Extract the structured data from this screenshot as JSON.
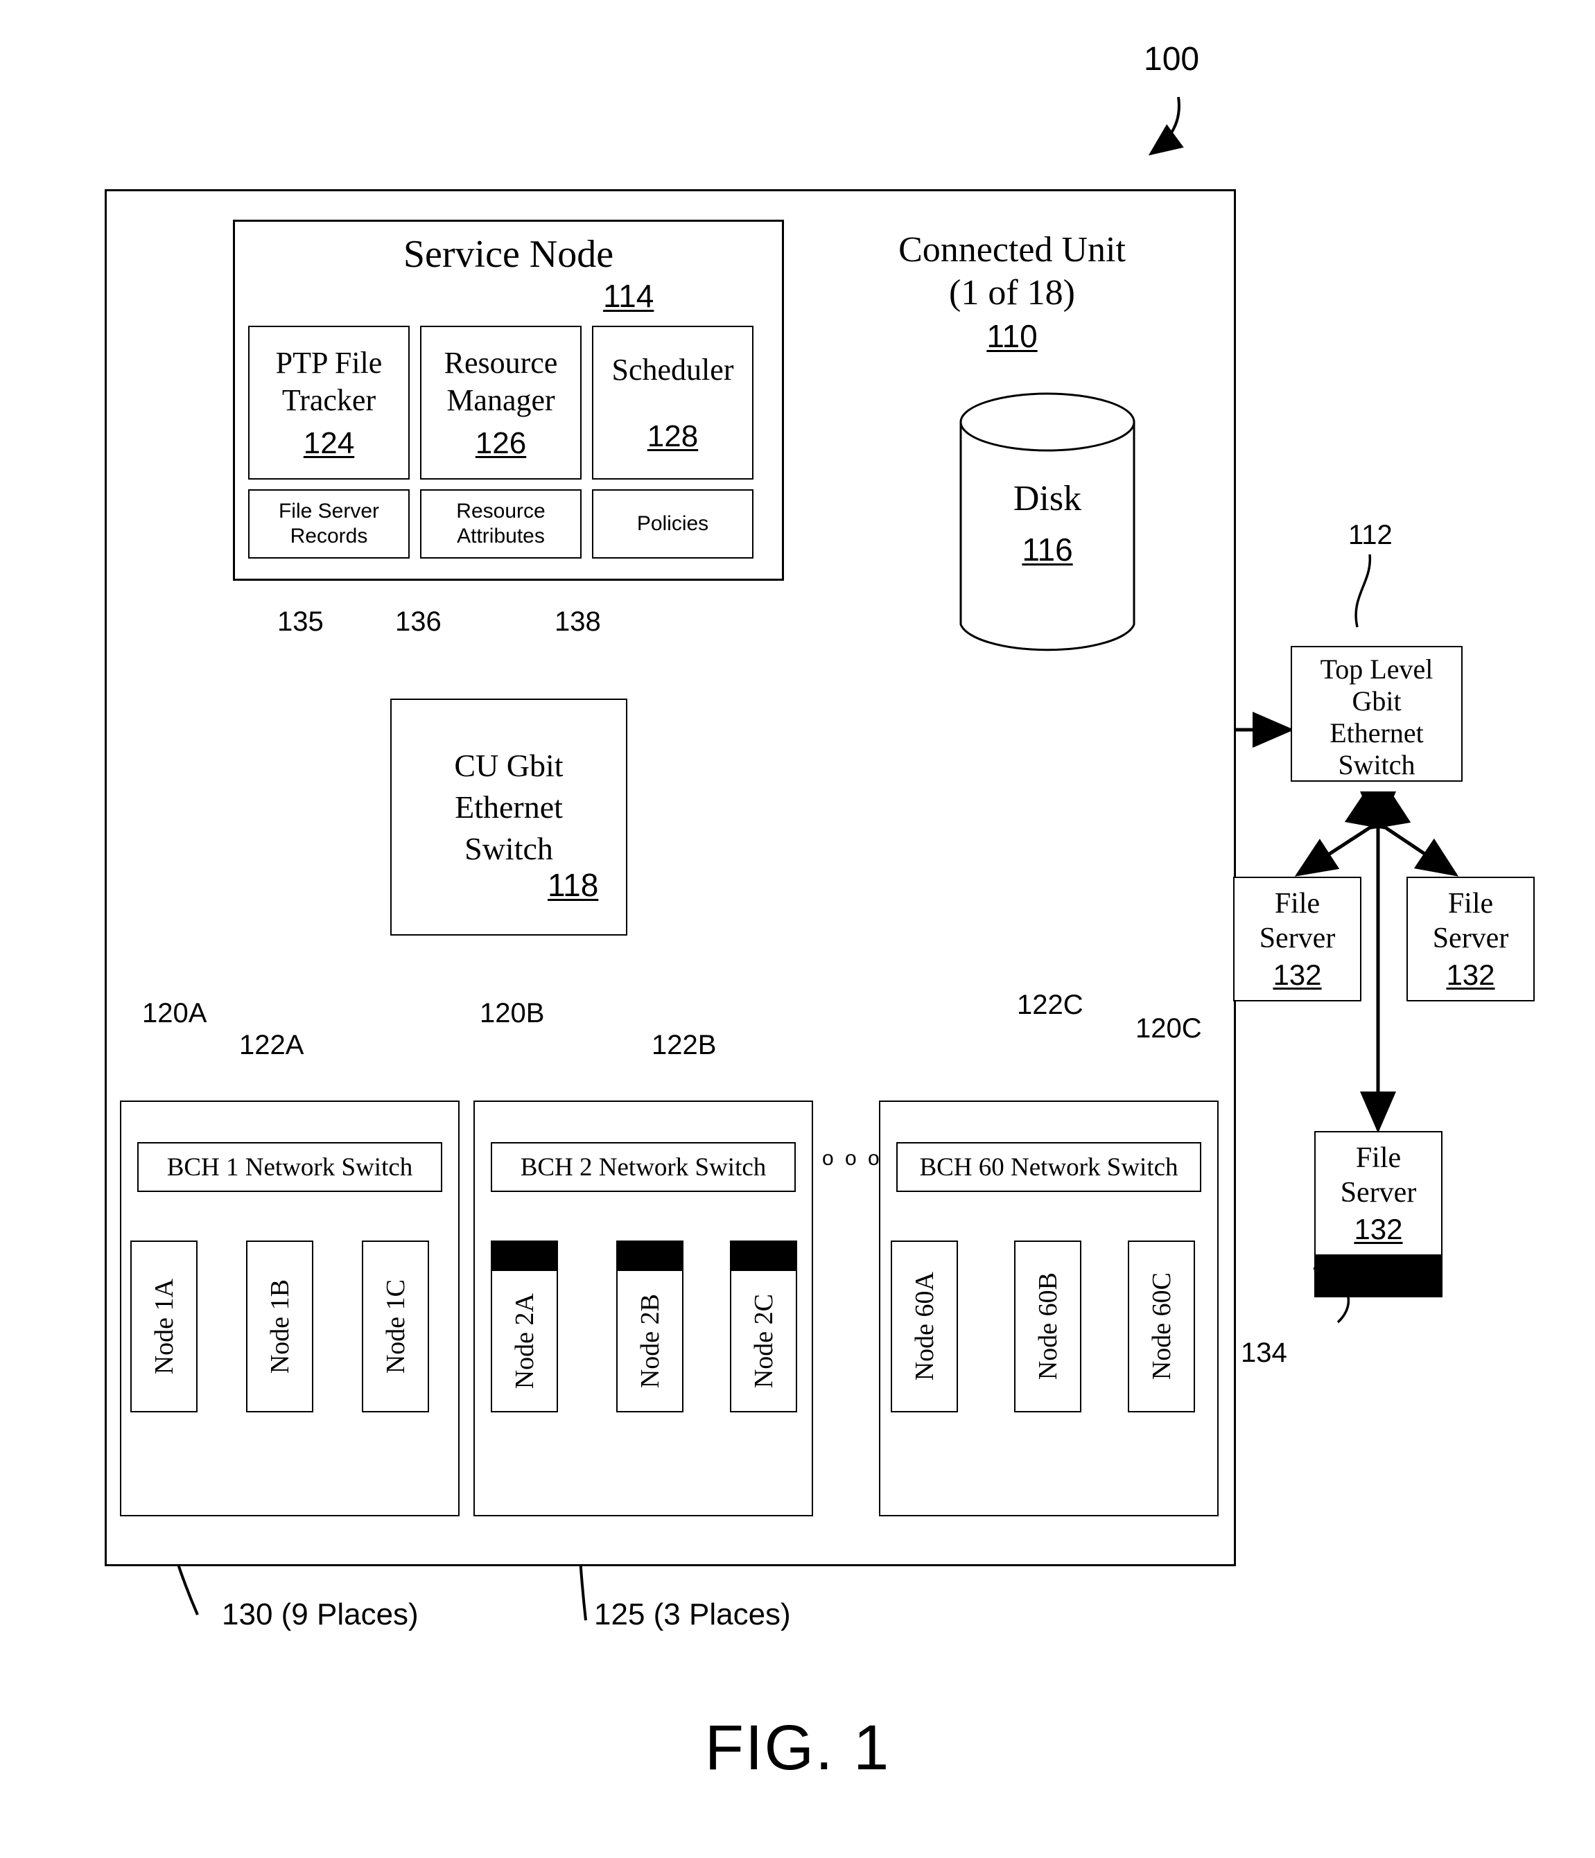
{
  "figure": {
    "caption": "FIG. 1",
    "system_ref": "100"
  },
  "connected_unit": {
    "title_line1": "Connected Unit",
    "title_line2": "(1 of 18)",
    "ref": "110"
  },
  "service_node": {
    "title": "Service Node",
    "ref": "114",
    "modules": [
      {
        "name_line1": "PTP File",
        "name_line2": "Tracker",
        "ref": "124"
      },
      {
        "name_line1": "Resource",
        "name_line2": "Manager",
        "ref": "126"
      },
      {
        "name_line1": "Scheduler",
        "name_line2": "",
        "ref": "128"
      }
    ],
    "stores": [
      {
        "line1": "File Server",
        "line2": "Records",
        "ref": "135"
      },
      {
        "line1": "Resource",
        "line2": "Attributes",
        "ref": "136"
      },
      {
        "line1": "Policies",
        "line2": "",
        "ref": "138"
      }
    ]
  },
  "disk": {
    "label": "Disk",
    "ref": "116"
  },
  "cu_switch": {
    "line1": "CU Gbit",
    "line2": "Ethernet",
    "line3": "Switch",
    "ref": "118"
  },
  "top_switch": {
    "line1": "Top Level",
    "line2": "Gbit",
    "line3": "Ethernet",
    "line4": "Switch",
    "ref": "112"
  },
  "file_servers": [
    {
      "line1": "File",
      "line2": "Server",
      "ref": "132",
      "has_black_bar": false
    },
    {
      "line1": "File",
      "line2": "Server",
      "ref": "132",
      "has_black_bar": false
    },
    {
      "line1": "File",
      "line2": "Server",
      "ref": "132",
      "has_black_bar": true
    }
  ],
  "file_server_bar_ref": "134",
  "racks": [
    {
      "rack_ref": "120A",
      "switch_ref": "122A",
      "switch_label": "BCH 1 Network Switch",
      "nodes": [
        {
          "label": "Node 1A",
          "has_black_bar": false
        },
        {
          "label": "Node 1B",
          "has_black_bar": false
        },
        {
          "label": "Node 1C",
          "has_black_bar": false
        }
      ]
    },
    {
      "rack_ref": "120B",
      "switch_ref": "122B",
      "switch_label": "BCH 2 Network Switch",
      "nodes": [
        {
          "label": "Node 2A",
          "has_black_bar": true
        },
        {
          "label": "Node 2B",
          "has_black_bar": true
        },
        {
          "label": "Node 2C",
          "has_black_bar": true
        }
      ]
    },
    {
      "rack_ref": "120C",
      "switch_ref": "122C",
      "switch_label": "BCH 60 Network Switch",
      "nodes": [
        {
          "label": "Node 60A",
          "has_black_bar": false
        },
        {
          "label": "Node 60B",
          "has_black_bar": false
        },
        {
          "label": "Node 60C",
          "has_black_bar": false
        }
      ]
    }
  ],
  "ellipsis": "o o o",
  "callouts": {
    "nodes_note": "130 (9 Places)",
    "bars_note": "125 (3 Places)"
  }
}
